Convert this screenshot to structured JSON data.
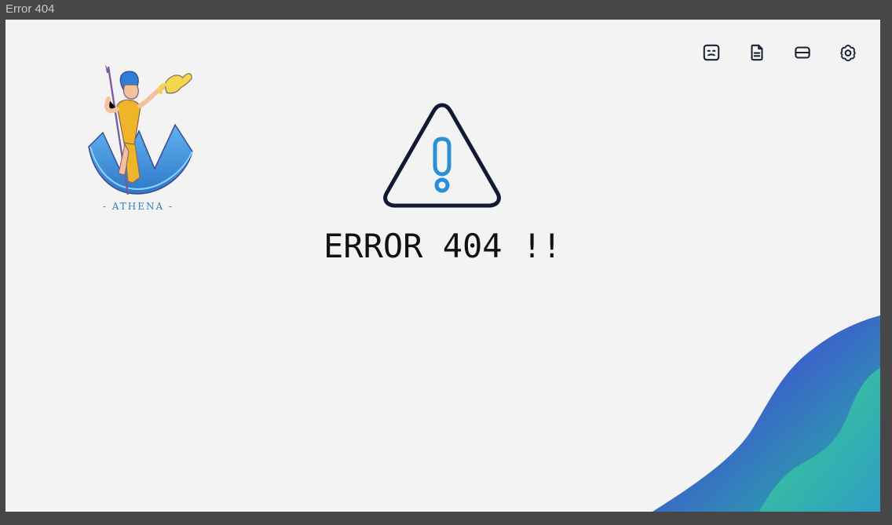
{
  "window": {
    "title": "Error 404"
  },
  "logo": {
    "text": "- ATHENA -"
  },
  "toolbar": {
    "icons": [
      "face-icon",
      "document-icon",
      "inbox-icon",
      "settings-icon"
    ]
  },
  "error": {
    "message": "ERROR 404 !!"
  },
  "colors": {
    "background": "#f3f3f3",
    "frame": "#474747",
    "accent_blue": "#2a8fd6",
    "dark": "#121a33",
    "wave_blue": "#3a66c8",
    "wave_green": "#39c98b"
  }
}
